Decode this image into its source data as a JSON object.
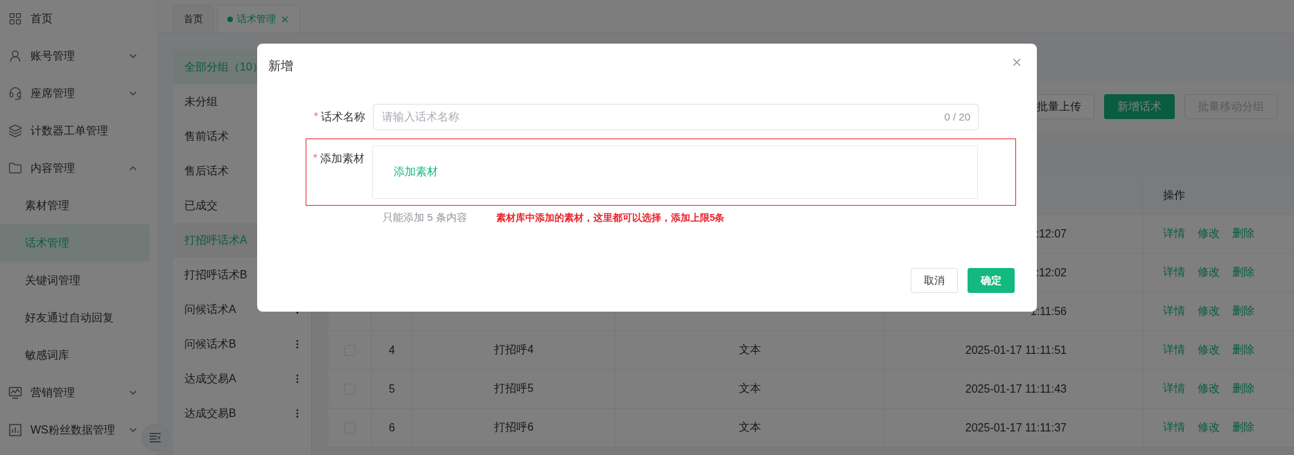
{
  "sidebar": {
    "items": [
      {
        "label": "首页",
        "selected": false
      },
      {
        "label": "账号管理",
        "selected": false,
        "expanded": false
      },
      {
        "label": "座席管理",
        "selected": false,
        "expanded": false
      },
      {
        "label": "计数器工单管理",
        "selected": false
      },
      {
        "label": "内容管理",
        "selected": false,
        "expanded": true,
        "children": [
          {
            "label": "素材管理",
            "selected": false
          },
          {
            "label": "话术管理",
            "selected": true
          },
          {
            "label": "关键词管理",
            "selected": false
          },
          {
            "label": "好友通过自动回复",
            "selected": false
          },
          {
            "label": "敏感词库",
            "selected": false
          }
        ]
      },
      {
        "label": "营销管理",
        "selected": false,
        "expanded": false
      },
      {
        "label": "WS粉丝数据管理",
        "selected": false,
        "expanded": false
      }
    ]
  },
  "tabs": [
    {
      "label": "首页",
      "selected": false,
      "closable": false
    },
    {
      "label": "话术管理",
      "selected": true,
      "closable": true
    }
  ],
  "groups": [
    {
      "label": "全部分组（10）",
      "kind": "all",
      "selected": false
    },
    {
      "label": "未分组",
      "kind": "group",
      "selected": false
    },
    {
      "label": "售前话术",
      "kind": "group",
      "selected": false
    },
    {
      "label": "售后话术",
      "kind": "group",
      "selected": false
    },
    {
      "label": "已成交",
      "kind": "group",
      "selected": false
    },
    {
      "label": "打招呼话术A",
      "kind": "group",
      "selected": true
    },
    {
      "label": "打招呼话术B",
      "kind": "group",
      "selected": false
    },
    {
      "label": "问候话术A",
      "kind": "group",
      "selected": false
    },
    {
      "label": "问候话术B",
      "kind": "group",
      "selected": false
    },
    {
      "label": "达成交易A",
      "kind": "group",
      "selected": false
    },
    {
      "label": "达成交易B",
      "kind": "group",
      "selected": false
    }
  ],
  "toolbar": [
    {
      "label": "批量上传",
      "kind": "default",
      "disabled": false
    },
    {
      "label": "新增话术",
      "kind": "primary",
      "disabled": false
    },
    {
      "label": "批量移动分组",
      "kind": "default",
      "disabled": true
    }
  ],
  "table": {
    "actions_header": "操作",
    "rows": [
      {
        "time": ":12:07",
        "actions": [
          "详情",
          "修改",
          "删除"
        ]
      },
      {
        "time": ":12:02",
        "actions": [
          "详情",
          "修改",
          "删除"
        ]
      },
      {
        "time": "1:11:56",
        "actions": [
          "详情",
          "修改",
          "删除"
        ]
      },
      {
        "checked": false,
        "index": "4",
        "name": "打招呼4",
        "type": "文本",
        "time": "2025-01-17 11:11:51",
        "actions": [
          "详情",
          "修改",
          "删除"
        ]
      },
      {
        "checked": false,
        "index": "5",
        "name": "打招呼5",
        "type": "文本",
        "time": "2025-01-17 11:11:43",
        "actions": [
          "详情",
          "修改",
          "删除"
        ]
      },
      {
        "checked": false,
        "index": "6",
        "name": "打招呼6",
        "type": "文本",
        "time": "2025-01-17 11:11:37",
        "actions": [
          "详情",
          "修改",
          "删除"
        ]
      }
    ]
  },
  "dialog": {
    "title": "新增",
    "name_field": {
      "label": "话术名称",
      "required_mark": "*",
      "placeholder": "请输入话术名称",
      "count": "0 / 20"
    },
    "material_field": {
      "label": "添加素材",
      "required_mark": "*",
      "link": "添加素材",
      "hint": "只能添加 5 条内容",
      "annotation": "素材库中添加的素材，这里都可以选择，添加上限5条"
    },
    "buttons": [
      {
        "label": "取消",
        "kind": "default"
      },
      {
        "label": "确定",
        "kind": "primary"
      }
    ]
  }
}
